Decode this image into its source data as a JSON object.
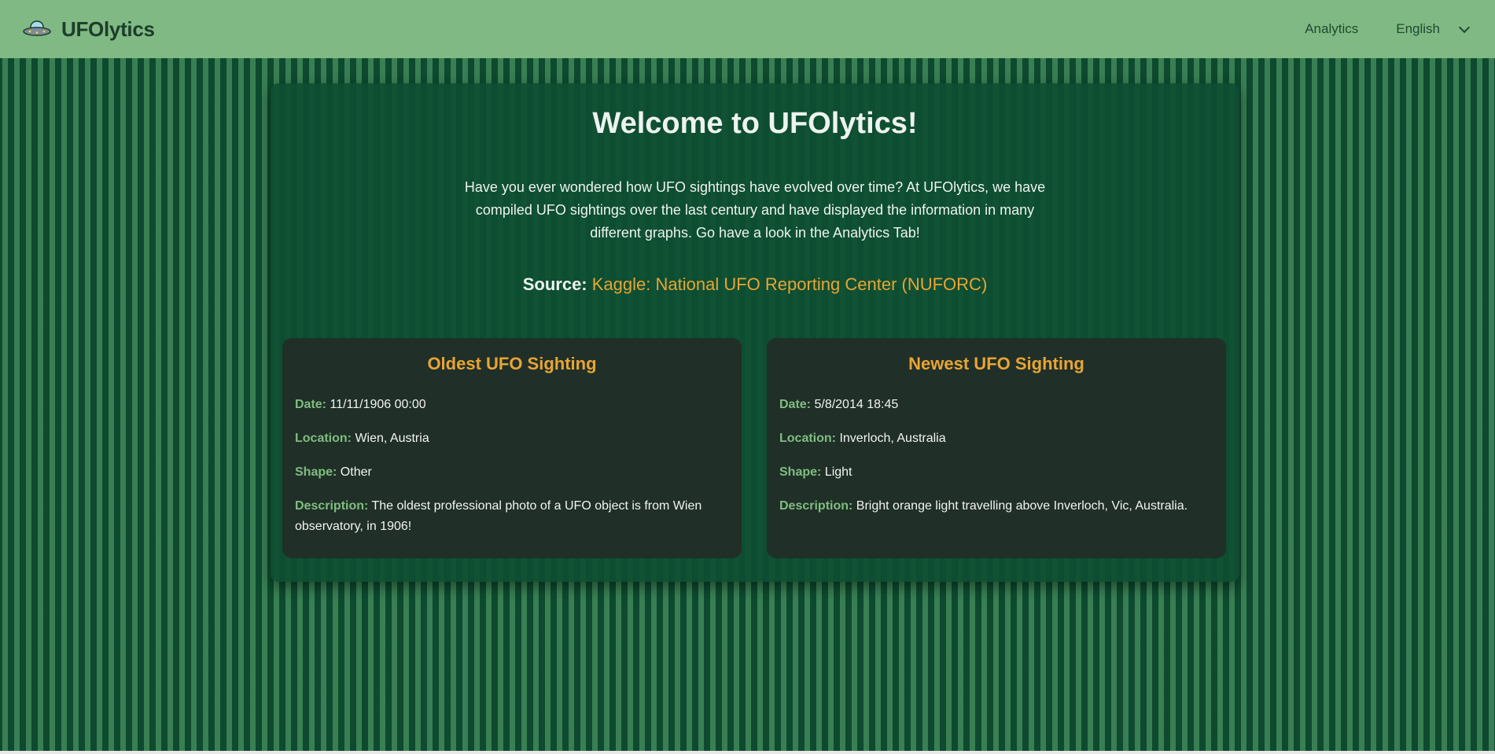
{
  "colors": {
    "navbar_bg": "#80b983",
    "page_bg": "#0d4a2f",
    "panel_bg": "#0e4e32",
    "card_bg": "#202f28",
    "accent_orange": "#e8a534",
    "label_green": "#7fbd80"
  },
  "nav": {
    "brand": "UFOlytics",
    "brand_icon": "ufo-icon",
    "links": [
      "Analytics"
    ],
    "language": "English"
  },
  "main": {
    "title": "Welcome to UFOlytics!",
    "intro": "Have you ever wondered how UFO sightings have evolved over time? At UFOlytics, we have compiled UFO sightings over the last century and have displayed the information in many different graphs. Go have a look in the Analytics Tab!",
    "source_label": "Source:",
    "source_link": "Kaggle: National UFO Reporting Center (NUFORC)"
  },
  "labels": {
    "date": "Date:",
    "location": "Location:",
    "shape": "Shape:",
    "description": "Description:"
  },
  "oldest": {
    "title": "Oldest UFO Sighting",
    "date": "11/11/1906 00:00",
    "location": "Wien, Austria",
    "shape": "Other",
    "description": "The oldest professional photo of a UFO object is from Wien observatory, in 1906!"
  },
  "newest": {
    "title": "Newest UFO Sighting",
    "date": "5/8/2014 18:45",
    "location": "Inverloch, Australia",
    "shape": "Light",
    "description": "Bright orange light travelling above Inverloch, Vic, Australia."
  }
}
